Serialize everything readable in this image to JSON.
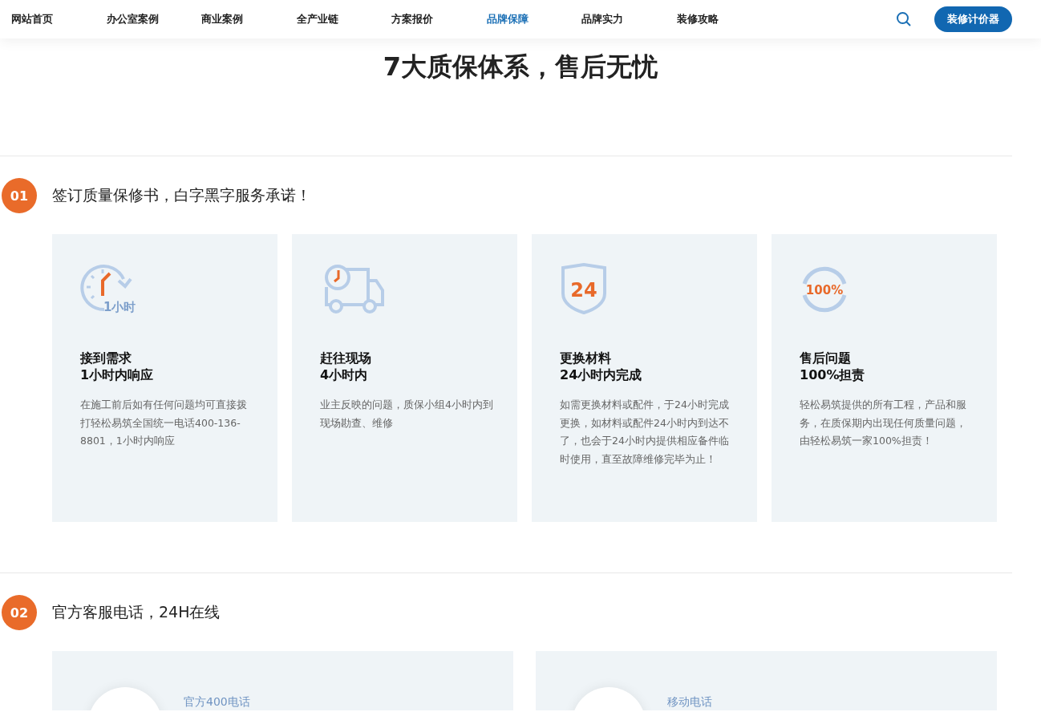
{
  "nav": {
    "items": [
      {
        "label": "网站首页",
        "selected": false
      },
      {
        "label": "办公室案例",
        "selected": false
      },
      {
        "label": "商业案例",
        "selected": false
      },
      {
        "label": "全产业链",
        "selected": false
      },
      {
        "label": "方案报价",
        "selected": false
      },
      {
        "label": "品牌保障",
        "selected": true
      },
      {
        "label": "品牌实力",
        "selected": false
      },
      {
        "label": "装修攻略",
        "selected": false
      }
    ],
    "cta": "装修计价器"
  },
  "title": "7大质保体系，售后无忧",
  "sections": [
    {
      "number": "01",
      "heading": "签订质量保修书，白字黑字服务承诺！",
      "cards": [
        {
          "kind": "clock",
          "icon_text": "1小时",
          "title": "接到需求",
          "subtitle": "1小时内响应",
          "text": "在施工前后如有任何问题均可直接拨打轻松易筑全国统一电话400-136-8801，1小时内响应"
        },
        {
          "kind": "truck",
          "title": "赶往现场",
          "subtitle": "4小时内",
          "text": "业主反映的问题，质保小组4小时内到现场勘查、维修"
        },
        {
          "kind": "shield",
          "icon_text": "24",
          "title": "更换材料",
          "subtitle": "24小时内完成",
          "text": "如需更换材料或配件，于24小时完成更换，如材料或配件24小时内到达不了，也会于24小时内提供相应备件临时使用，直至故障维修完毕为止！"
        },
        {
          "kind": "badge",
          "icon_text": "100%",
          "title": "售后问题",
          "subtitle": "100%担责",
          "text": "轻松易筑提供的所有工程，产品和服务，在质保期内出现任何质量问题，由轻松易筑一家100%担责！"
        }
      ]
    },
    {
      "number": "02",
      "heading": "官方客服电话，24H在线",
      "phones": [
        {
          "label": "官方400电话"
        },
        {
          "label": "移动电话"
        }
      ]
    }
  ]
}
